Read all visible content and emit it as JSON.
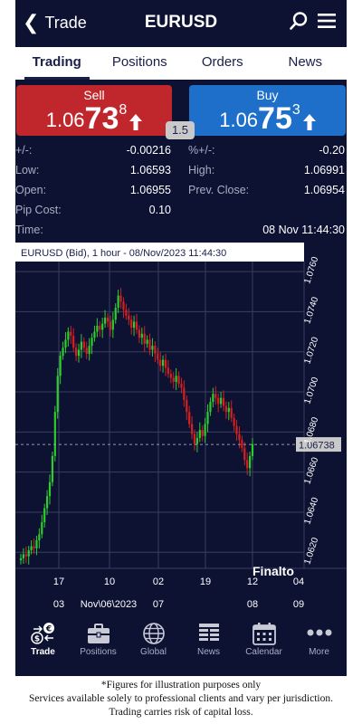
{
  "header": {
    "back_label": "Trade",
    "title": "EURUSD"
  },
  "tabs": [
    {
      "label": "Trading",
      "active": true
    },
    {
      "label": "Positions",
      "active": false
    },
    {
      "label": "Orders",
      "active": false
    },
    {
      "label": "News",
      "active": false
    }
  ],
  "sell": {
    "label": "Sell",
    "prefix": "1.06",
    "big": "73",
    "pip": "8",
    "direction": "up"
  },
  "buy": {
    "label": "Buy",
    "prefix": "1.06",
    "big": "75",
    "pip": "3",
    "direction": "up"
  },
  "spread": "1.5",
  "stats": [
    {
      "left_label": "+/-:",
      "left_value": "-0.00216",
      "right_label": "%+/-:",
      "right_value": "-0.20"
    },
    {
      "left_label": "Low:",
      "left_value": "1.06593",
      "right_label": "High:",
      "right_value": "1.06991"
    },
    {
      "left_label": "Open:",
      "left_value": "1.06955",
      "right_label": "Prev. Close:",
      "right_value": "1.06954"
    },
    {
      "left_label": "Pip Cost:",
      "left_value": "0.10",
      "right_label": "",
      "right_value": ""
    },
    {
      "left_label": "Time:",
      "left_value": "",
      "right_label": "",
      "right_value": "08 Nov 11:44:30"
    }
  ],
  "chart": {
    "caption": "EURUSD (Bid), 1 hour - 08/Nov/2023 11:44:30",
    "y_ticks": [
      "1.0760",
      "1.0740",
      "1.0720",
      "1.0700",
      "1.0680",
      "1.0660",
      "1.0640",
      "1.0620"
    ],
    "current_price": "1.06738",
    "x_ticks": [
      {
        "top": "17",
        "bottom": "03"
      },
      {
        "top": "10",
        "bottom": "Nov\\06\\2023"
      },
      {
        "top": "02",
        "bottom": "07"
      },
      {
        "top": "19",
        "bottom": ""
      },
      {
        "top": "12",
        "bottom": "08"
      },
      {
        "top": "04",
        "bottom": "09"
      }
    ],
    "watermark": "Finalto",
    "colors": {
      "up": "#2ecc2e",
      "down": "#d42020",
      "grid": "#3a3f5c",
      "current_line": "#9a9a9a"
    }
  },
  "chart_data": {
    "type": "candlestick",
    "title": "EURUSD (Bid), 1 hour - 08/Nov/2023 11:44:30",
    "ylim": [
      1.0612,
      1.0765
    ],
    "current": 1.06738,
    "closes": [
      1.0617,
      1.0619,
      1.0618,
      1.0621,
      1.0623,
      1.0622,
      1.0626,
      1.0629,
      1.0635,
      1.0642,
      1.0648,
      1.0655,
      1.0668,
      1.069,
      1.0708,
      1.0718,
      1.0722,
      1.0726,
      1.073,
      1.0728,
      1.0722,
      1.0718,
      1.0721,
      1.0725,
      1.0722,
      1.0719,
      1.0723,
      1.0727,
      1.073,
      1.0733,
      1.0731,
      1.0734,
      1.0737,
      1.0735,
      1.0731,
      1.0736,
      1.0742,
      1.0748,
      1.0745,
      1.0741,
      1.0738,
      1.0736,
      1.0732,
      1.0735,
      1.0731,
      1.0727,
      1.0729,
      1.0724,
      1.0726,
      1.0721,
      1.0723,
      1.0719,
      1.0716,
      1.0713,
      1.0716,
      1.0712,
      1.0709,
      1.0707,
      1.0705,
      1.0708,
      1.0704,
      1.0702,
      1.0696,
      1.069,
      1.0684,
      1.0679,
      1.0674,
      1.0677,
      1.0681,
      1.0678,
      1.0684,
      1.069,
      1.0695,
      1.0699,
      1.0697,
      1.0694,
      1.0697,
      1.0693,
      1.069,
      1.0692,
      1.0687,
      1.0683,
      1.0679,
      1.0676,
      1.0672,
      1.0666,
      1.0662,
      1.0668,
      1.0674
    ],
    "y_ticks": [
      1.076,
      1.074,
      1.072,
      1.07,
      1.068,
      1.066,
      1.064,
      1.062
    ]
  },
  "nav": [
    {
      "label": "Trade",
      "icon": "trade-icon",
      "active": true
    },
    {
      "label": "Positions",
      "icon": "briefcase-icon",
      "active": false
    },
    {
      "label": "Global",
      "icon": "globe-icon",
      "active": false
    },
    {
      "label": "News",
      "icon": "news-icon",
      "active": false
    },
    {
      "label": "Calendar",
      "icon": "calendar-icon",
      "active": false
    },
    {
      "label": "More",
      "icon": "more-dots-icon",
      "active": false
    }
  ],
  "disclaimer": [
    "*Figures for illustration purposes only",
    "Services available solely to professional clients and vary per jurisdiction.",
    "Trading carries risk of capital loss."
  ]
}
